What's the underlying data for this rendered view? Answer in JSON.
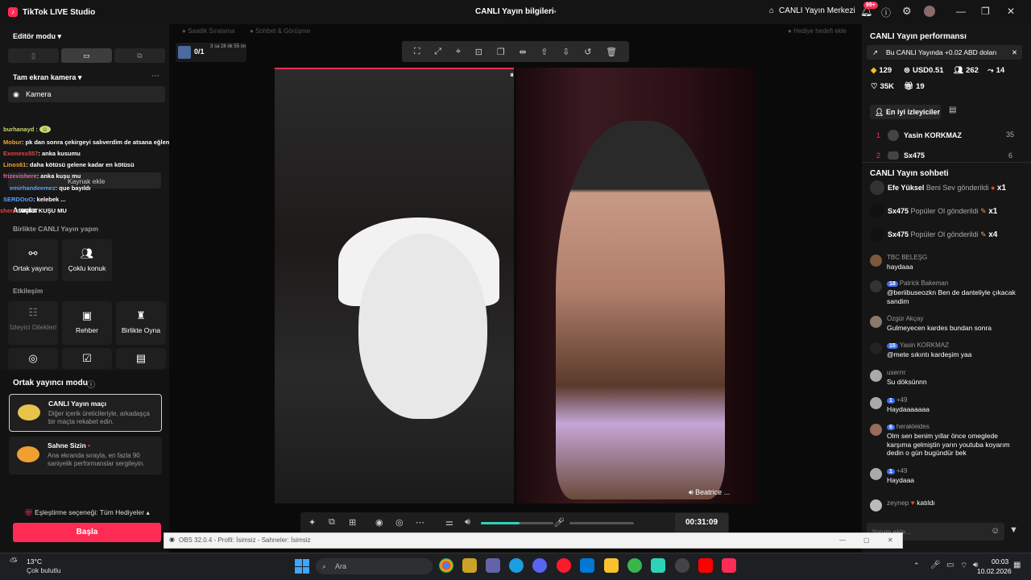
{
  "titlebar": {
    "app_name": "TikTok LIVE Studio",
    "center_title": "CANLI Yayın bilgileri",
    "live_center": "CANLI Yayın Merkezi",
    "notif_count": "99+"
  },
  "left": {
    "editor_mode": "Editör modu",
    "fullscreen_camera": "Tam ekran kamera",
    "camera": "Kamera",
    "add_source": "Kaynak ekle",
    "tools": "Araçlar",
    "go_live_together": "Birlikte CANLI Yayın yapın",
    "cohost_tile": "Ortak yayıncı",
    "multi_guest_tile": "Çoklu konuk",
    "interaction": "Etkileşim",
    "viewer_wishes": "İzleyici Dilekleri",
    "guide": "Rehber",
    "play_together": "Birlikte Oyna",
    "overlay_chat": [
      {
        "user": "burhanayd :",
        "text": ""
      },
      {
        "user": "Mobur",
        "text": ": pk dan sonra çekirgeyi salıverdim de atsana eğlenek biraz"
      },
      {
        "user": "Exoness557",
        "text": ": anka kusumu"
      },
      {
        "user": "Linos61",
        "text": ": daha kötüsü gelene kadar en kötüsü"
      },
      {
        "user": "frizexishere",
        "text": ": anka kuşu mu"
      },
      {
        "user": "emirhandeemez",
        "text": ": que bayıldı"
      },
      {
        "user": "SERDOoO",
        "text": ": kelebek ..."
      },
      {
        "user": "shere",
        "text": ": ANKA KUŞU MU"
      }
    ]
  },
  "cohost_mode": {
    "title": "Ortak yayıncı modu",
    "match_title": "CANLI Yayın maçı",
    "match_desc": "Diğer içerik üreticileriyle, arkadaşça bir maçta rekabet edin.",
    "stage_title": "Sahne Sizin",
    "stage_desc": "Ana ekranda sırayla, en fazla 90 saniyelik performanslar sergileyin.",
    "pairing": "Eşleştirme seçeneği: Tüm Hediyeler",
    "go_live": "Başla"
  },
  "stage": {
    "tab_fans": "Saatlik Sıralama",
    "tab_chat": "Sohbet & Görüşme",
    "gift_goal": "Hediye hedefi ekle",
    "battle_count": "0/1",
    "battle_timer": "3 sa 28 dk 55 sn",
    "guest_name": "Beatrice ...",
    "timer": "00:31:09",
    "volume_level": 0.53
  },
  "right": {
    "perf_title": "CANLI Yayın performansı",
    "promo": "Bu CANLI Yayında +0.02 ABD doları",
    "stats": {
      "coins": "129",
      "usd": "USD0.51",
      "viewers": "262",
      "shares": "14",
      "likes": "35K",
      "gifters": "19"
    },
    "top_viewers_tab": "En iyi izleyiciler",
    "top_viewers": [
      {
        "rank": "1",
        "name": "Yasin KORKMAZ",
        "score": "35"
      },
      {
        "rank": "2",
        "name": "Sx475",
        "score": "6"
      }
    ],
    "chat_title": "CANLI Yayın sohbeti",
    "gift_events": [
      {
        "user": "Efe Yüksel",
        "action": "Beni Sev gönderildi",
        "count": "x1"
      },
      {
        "user": "Sx475",
        "action": "Popüler Ol gönderildi",
        "count": "x1"
      },
      {
        "user": "Sx475",
        "action": "Popüler Ol gönderildi",
        "count": "x4"
      }
    ],
    "messages": [
      {
        "user": "TBC BELEŞG",
        "level": "",
        "text": "haydaaa"
      },
      {
        "user": "Patrick Bakeman",
        "level": "18",
        "text": "@beriibuseozkn Ben de danteliyle çıkacak sandim"
      },
      {
        "user": "Özgür Akçay",
        "level": "",
        "text": "Gulmeyecen kardes bundan sonra"
      },
      {
        "user": "Yasin KORKMAZ",
        "level": "15",
        "text": "@mete sıkıntı kardeşim yaa"
      },
      {
        "user": "userrrr",
        "level": "",
        "text": "Su döksünnn"
      },
      {
        "user": "+49",
        "level": "1",
        "text": "Haydaaaaaaa"
      },
      {
        "user": "herakleides",
        "level": "6",
        "text": "Olm sen benim yıllar önce omeglede karşıma gelmiştin yarın youtuba koyarım dedin o gün bugündür bek"
      },
      {
        "user": "+49",
        "level": "1",
        "text": "Haydaaa"
      },
      {
        "user": "zeynep",
        "level": "",
        "text": "katıldı"
      }
    ],
    "comment_placeholder": "Yorum ekle..."
  },
  "obs": {
    "title": "OBS 32.0.4 - Profil: İsimsiz - Sahneler: İsimsiz"
  },
  "taskbar": {
    "weather_temp": "13°C",
    "weather_desc": "Çok bulutlu",
    "search": "Ara",
    "time": "00:03",
    "date": "10.02.2026"
  }
}
